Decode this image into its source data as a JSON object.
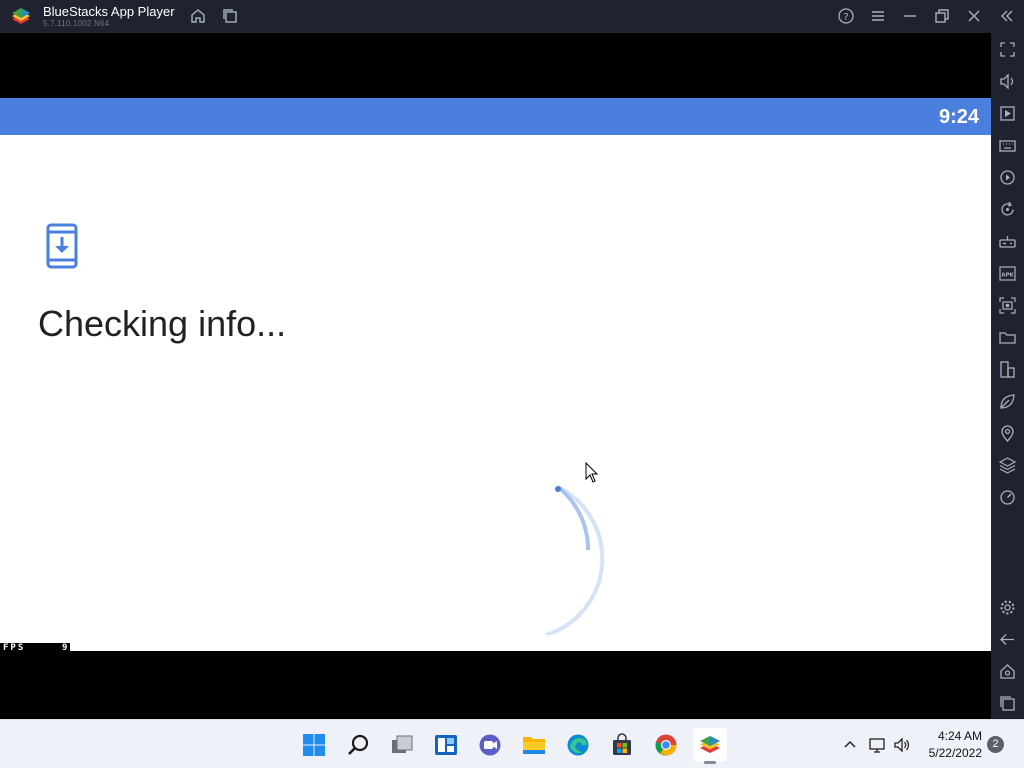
{
  "titlebar": {
    "app_name": "BlueStacks App Player",
    "version": "5.7.110.1002 N64",
    "icons": [
      "home-icon",
      "multi-instance-icon",
      "help-icon",
      "menu-icon",
      "minimize-icon",
      "restore-icon",
      "close-icon",
      "collapse-sidebar-icon"
    ]
  },
  "android": {
    "clock": "9:24",
    "message": "Checking info...",
    "fps_label": "FPS",
    "fps_value": "9",
    "accent_color": "#4a7fdd"
  },
  "sidebar": {
    "icons": [
      "fullscreen-icon",
      "volume-icon",
      "media-icon",
      "keyboard-icon",
      "macro-record-icon",
      "rotate-icon",
      "gamepad-icon",
      "install-apk-icon",
      "screenshot-icon",
      "folder-icon",
      "multi-instance-sync-icon",
      "eco-mode-icon",
      "location-icon",
      "layers-icon",
      "performance-icon",
      "settings-icon",
      "back-icon",
      "android-home-icon",
      "recent-apps-icon"
    ]
  },
  "taskbar": {
    "apps": [
      "windows-start-icon",
      "search-icon",
      "task-view-icon",
      "widgets-icon",
      "teams-chat-icon",
      "file-explorer-icon",
      "edge-icon",
      "store-icon",
      "chrome-icon",
      "bluestacks-icon"
    ],
    "time": "4:24 AM",
    "date": "5/22/2022",
    "notification_count": "2"
  }
}
